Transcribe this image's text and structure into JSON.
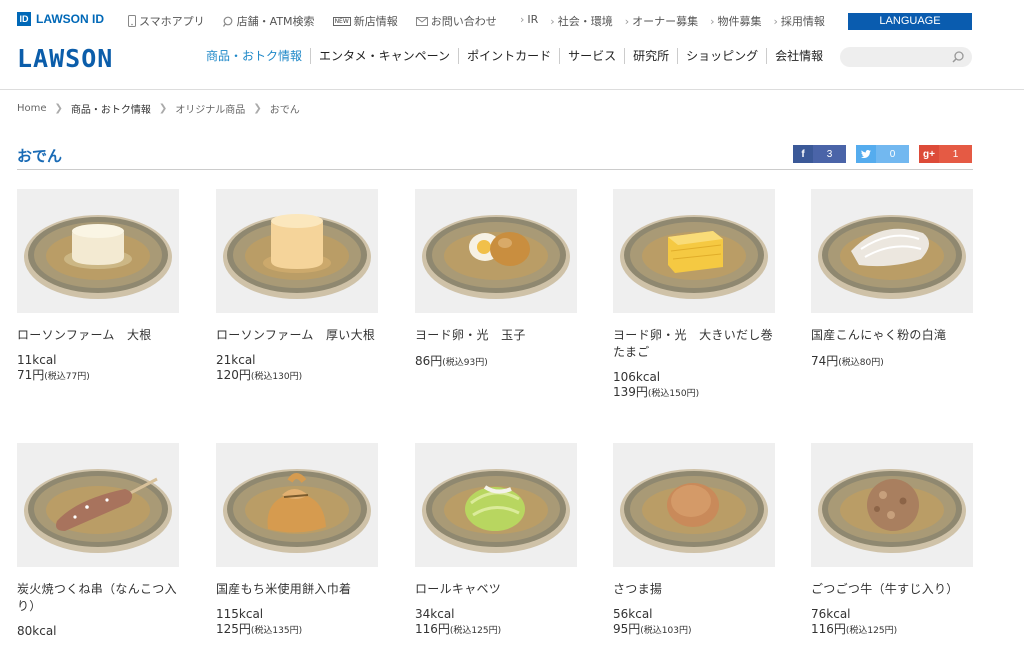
{
  "topbar": {
    "lawson_id": "LAWSON ID",
    "links": [
      {
        "label": "スマホアプリ",
        "icon": "smartphone-icon"
      },
      {
        "label": "店舗・ATM検索",
        "icon": "search-icon"
      },
      {
        "label": "新店情報",
        "icon": "new-badge-icon",
        "badge": "NEW"
      },
      {
        "label": "お問い合わせ",
        "icon": "mail-icon"
      }
    ],
    "right_links": [
      "IR",
      "社会・環境",
      "オーナー募集",
      "物件募集",
      "採用情報"
    ],
    "language": "LANGUAGE"
  },
  "logo": "LAWSON",
  "mainnav": [
    {
      "label": "商品・おトク情報",
      "active": true
    },
    {
      "label": "エンタメ・キャンペーン",
      "active": false
    },
    {
      "label": "ポイントカード",
      "active": false
    },
    {
      "label": "サービス",
      "active": false
    },
    {
      "label": "研究所",
      "active": false
    },
    {
      "label": "ショッピング",
      "active": false
    },
    {
      "label": "会社情報",
      "active": false
    }
  ],
  "search": {
    "placeholder": ""
  },
  "breadcrumb": [
    "Home",
    "商品・おトク情報",
    "オリジナル商品",
    "おでん"
  ],
  "page_title": "おでん",
  "share": {
    "facebook": "3",
    "twitter": "0",
    "googleplus": "1"
  },
  "colors": {
    "brand": "#0b5daa",
    "accent": "#1e88c8",
    "title": "#1a6bb5"
  },
  "products": [
    {
      "name": "ローソンファーム　大根",
      "kcal": "11kcal",
      "price": "71円",
      "tax": "(税込77円)",
      "food": "daikon"
    },
    {
      "name": "ローソンファーム　厚い大根",
      "kcal": "21kcal",
      "price": "120円",
      "tax": "(税込130円)",
      "food": "daikon-thick"
    },
    {
      "name": "ヨード卵・光　玉子",
      "kcal": "",
      "price": "86円",
      "tax": "(税込93円)",
      "food": "egg"
    },
    {
      "name": "ヨード卵・光　大きいだし巻たまご",
      "kcal": "106kcal",
      "price": "139円",
      "tax": "(税込150円)",
      "food": "tamago"
    },
    {
      "name": "国産こんにゃく粉の白滝",
      "kcal": "",
      "price": "74円",
      "tax": "(税込80円)",
      "food": "shirataki"
    },
    {
      "name": "炭火焼つくね串（なんこつ入り）",
      "kcal": "80kcal",
      "price": "",
      "tax": "",
      "food": "tsukune"
    },
    {
      "name": "国産もち米使用餅入巾着",
      "kcal": "115kcal",
      "price": "125円",
      "tax": "(税込135円)",
      "food": "kinchaku"
    },
    {
      "name": "ロールキャベツ",
      "kcal": "34kcal",
      "price": "116円",
      "tax": "(税込125円)",
      "food": "cabbage"
    },
    {
      "name": "さつま揚",
      "kcal": "56kcal",
      "price": "95円",
      "tax": "(税込103円)",
      "food": "satsuma"
    },
    {
      "name": "ごつごつ牛（牛すじ入り）",
      "kcal": "76kcal",
      "price": "116円",
      "tax": "(税込125円)",
      "food": "beef"
    }
  ]
}
